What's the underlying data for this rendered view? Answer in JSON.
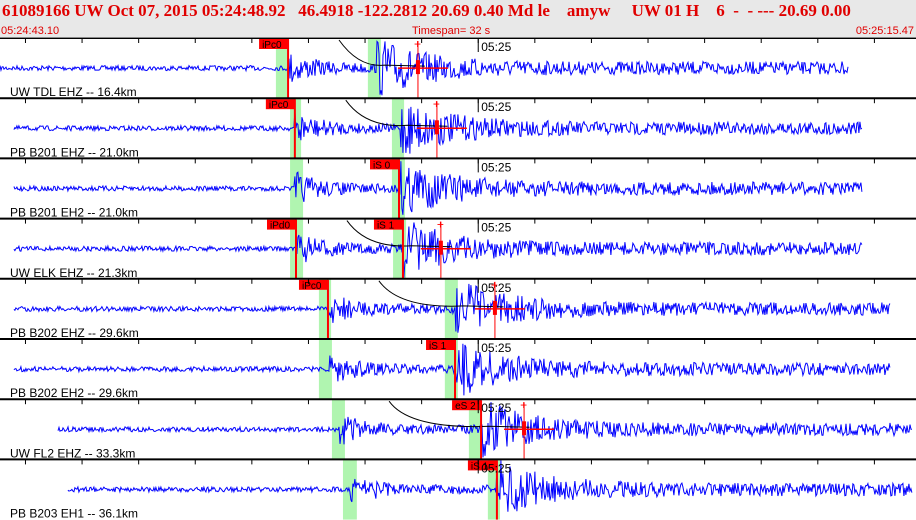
{
  "header": {
    "title": "61089166 UW Oct 07, 2015 05:24:48.92   46.4918 -122.2812 20.69 0.40 Md le    amyw     UW 01 H    6  -  - --- 20.69 0.00",
    "start_time": "05:24:43.10",
    "timespan": "Timespan=  32 s",
    "end_time": "05:25:15.47"
  },
  "minute_label": "05:25",
  "minute_offset_s": 16.9,
  "span_s": 32.37,
  "colors": {
    "trace": "#0000ff",
    "pick": "#ff0000",
    "window": "#b0f5b0",
    "text": "#e00000"
  },
  "traces": [
    {
      "label": "UW TDL EHZ -- 16.4km",
      "picks": [
        {
          "name": "iPc0",
          "t": 10.18
        }
      ],
      "windows": [
        [
          9.75,
          10.18
        ],
        [
          13.0,
          13.46
        ]
      ],
      "cursor": 14.77,
      "range": [
        0,
        29.97
      ],
      "p": 10.18,
      "s": 13.3,
      "curve": true
    },
    {
      "label": "PB B201 EHZ -- 21.0km",
      "picks": [
        {
          "name": "iPc0",
          "t": 10.42
        }
      ],
      "windows": [
        [
          10.25,
          10.64
        ],
        [
          13.85,
          14.28
        ]
      ],
      "cursor": 15.44,
      "range": [
        0.49,
        30.46
      ],
      "p": 10.42,
      "s": 14.1,
      "curve": true
    },
    {
      "label": "PB B201 EH2 -- 21.0km",
      "picks": [
        {
          "name": "iS 0",
          "t": 14.1
        }
      ],
      "windows": [
        [
          10.25,
          10.71
        ],
        [
          13.85,
          14.31
        ]
      ],
      "cursor": null,
      "range": [
        0.49,
        30.46
      ],
      "p": 10.42,
      "s": 14.1,
      "curve": false
    },
    {
      "label": "UW ELK EHZ -- 21.3km",
      "picks": [
        {
          "name": "iPd0",
          "t": 10.46
        },
        {
          "name": "iS 1",
          "t": 14.24
        }
      ],
      "windows": [
        [
          10.25,
          10.71
        ],
        [
          13.89,
          14.35
        ]
      ],
      "cursor": 15.58,
      "range": [
        0.49,
        30.46
      ],
      "p": 10.46,
      "s": 14.24,
      "curve": true
    },
    {
      "label": "PB B202 EHZ -- 29.6km",
      "picks": [
        {
          "name": "iPc0",
          "t": 11.59
        }
      ],
      "windows": [
        [
          11.27,
          11.7
        ],
        [
          15.72,
          16.18
        ]
      ],
      "cursor": 17.49,
      "range": [
        0.49,
        31.45
      ],
      "p": 11.59,
      "s": 16.08,
      "curve": true
    },
    {
      "label": "PB B202 EH2 -- 29.6km",
      "picks": [
        {
          "name": "iS 1",
          "t": 16.08
        }
      ],
      "windows": [
        [
          11.27,
          11.73
        ],
        [
          15.72,
          16.18
        ]
      ],
      "cursor": null,
      "range": [
        0.49,
        31.45
      ],
      "p": 11.59,
      "s": 16.08,
      "curve": false
    },
    {
      "label": "UW FL2 EHZ -- 33.3km",
      "picks": [
        {
          "name": "eS 2",
          "t": 17.0
        }
      ],
      "windows": [
        [
          11.73,
          12.19
        ],
        [
          16.57,
          17.0
        ]
      ],
      "cursor": 18.52,
      "range": [
        2.05,
        32.23
      ],
      "p": 11.95,
      "s": 17.0,
      "curve": true
    },
    {
      "label": "PB B203 EH1 -- 36.1km",
      "picks": [
        {
          "name": "iS 1",
          "t": 17.56
        }
      ],
      "windows": [
        [
          12.12,
          12.61
        ],
        [
          17.24,
          17.67
        ]
      ],
      "cursor": null,
      "range": [
        2.4,
        32.23
      ],
      "p": 12.4,
      "s": 17.56,
      "curve": false
    }
  ]
}
